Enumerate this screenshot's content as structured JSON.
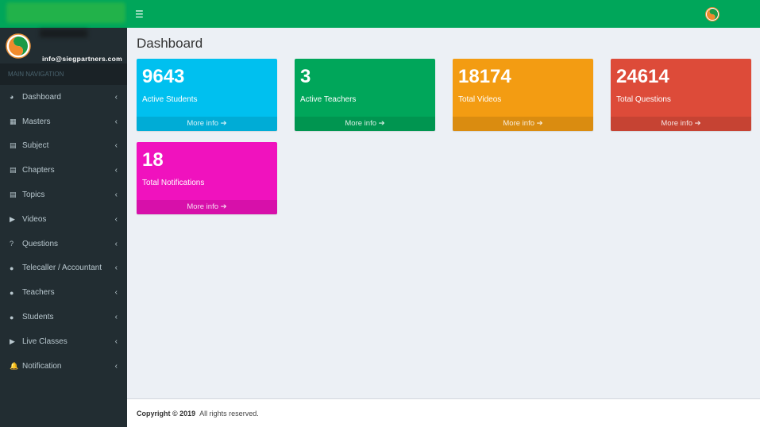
{
  "header": {
    "menu_icon": "hamburger-icon"
  },
  "sidebar": {
    "email": "info@siegpartners.com",
    "nav_header": "MAIN NAVIGATION",
    "items": [
      {
        "label": "Dashboard",
        "icon": "dashboard-icon",
        "glyph": "◕"
      },
      {
        "label": "Masters",
        "icon": "grid-icon",
        "glyph": "▦"
      },
      {
        "label": "Subject",
        "icon": "book-icon",
        "glyph": "▤"
      },
      {
        "label": "Chapters",
        "icon": "book-icon",
        "glyph": "▤"
      },
      {
        "label": "Topics",
        "icon": "book-icon",
        "glyph": "▤"
      },
      {
        "label": "Videos",
        "icon": "play-icon",
        "glyph": "▶"
      },
      {
        "label": "Questions",
        "icon": "question-icon",
        "glyph": "?"
      },
      {
        "label": "Telecaller / Accountant",
        "icon": "user-icon",
        "glyph": "●"
      },
      {
        "label": "Teachers",
        "icon": "user-icon",
        "glyph": "●"
      },
      {
        "label": "Students",
        "icon": "user-icon",
        "glyph": "●"
      },
      {
        "label": "Live Classes",
        "icon": "play-icon",
        "glyph": "▶"
      },
      {
        "label": "Notification",
        "icon": "bell-icon",
        "glyph": "🔔"
      }
    ]
  },
  "main": {
    "title": "Dashboard",
    "boxes": [
      {
        "value": "9643",
        "label": "Active Students",
        "more": "More info",
        "color": "#00c0ef"
      },
      {
        "value": "3",
        "label": "Active Teachers",
        "more": "More info",
        "color": "#00a65a"
      },
      {
        "value": "18174",
        "label": "Total Videos",
        "more": "More info",
        "color": "#f39c12"
      },
      {
        "value": "24614",
        "label": "Total Questions",
        "more": "More info",
        "color": "#dd4b39"
      },
      {
        "value": "18",
        "label": "Total Notifications",
        "more": "More info",
        "color": "#f012be"
      }
    ]
  },
  "footer": {
    "copyright": "Copyright © 2019",
    "rights": "All rights reserved."
  }
}
